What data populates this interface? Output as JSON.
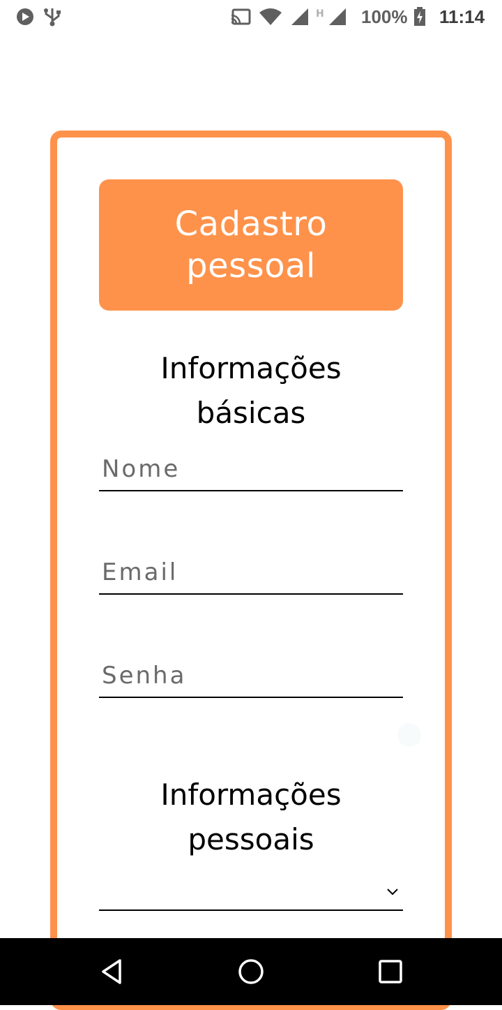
{
  "status_bar": {
    "battery_percent": "100%",
    "time": "11:14",
    "icons": [
      "play-store-notification-icon",
      "usb-icon",
      "cast-icon",
      "wifi-icon",
      "cellular-signal-icon",
      "h-network-icon",
      "cellular-signal-2-icon",
      "battery-charging-icon"
    ]
  },
  "header": {
    "title": "Cadastro pessoal"
  },
  "basic_info": {
    "title": "Informações básicas",
    "name_placeholder": "Nome",
    "email_placeholder": "Email",
    "password_placeholder": "Senha"
  },
  "personal_info": {
    "title": "Informações pessoais",
    "select_value": ""
  },
  "nav_bar": {
    "icons": [
      "back-icon",
      "home-icon",
      "recents-icon"
    ]
  },
  "colors": {
    "accent": "#fe924b",
    "nav_background": "#000000"
  }
}
